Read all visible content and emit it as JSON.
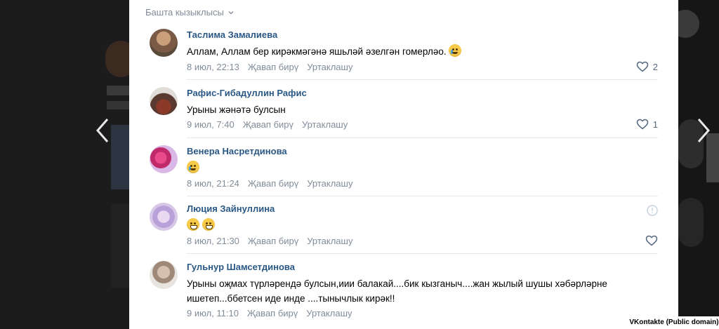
{
  "sort_label": "Башта кызыклысы",
  "credit": "VKontakte (Public domain)",
  "colors": {
    "link": "#2a5885",
    "meta": "#818c99",
    "background": "#ffffff"
  },
  "comments": [
    {
      "author": "Таслима Замалиева",
      "text": "Аллам, Аллам бер кирәкмәгәнә яшьләй әзелгән гомерләо.",
      "emoji": [
        "crying-face"
      ],
      "time": "8 июл, 22:13",
      "reply": "Җавап бирү",
      "share": "Уртаклашу",
      "likes": "2"
    },
    {
      "author": "Рафис-Гибадуллин Рафис",
      "text": "Урыны жәнәтә булсын",
      "emoji": [],
      "time": "9 июл, 7:40",
      "reply": "Җавап бирү",
      "share": "Уртаклашу",
      "likes": "1"
    },
    {
      "author": "Венера Насретдинова",
      "text": "",
      "emoji": [
        "crying-face"
      ],
      "time": "8 июл, 21:24",
      "reply": "Җавап бирү",
      "share": "Уртаклашу",
      "likes": ""
    },
    {
      "author": "Люция Зайнуллина",
      "text": "",
      "emoji": [
        "grimacing-face",
        "grimacing-face"
      ],
      "time": "8 июл, 21:30",
      "reply": "Җавап бирү",
      "share": "Уртаклашу",
      "likes": ""
    },
    {
      "author": "Гульнур Шамсетдинова",
      "text": "Урыны оҗмах түрләрендә булсын,иии балакай....бик кызганыч....жан жылый шушы хәбәрләрне ишетеп...ббетсен иде инде ....тынычлык кирәк!!",
      "emoji": [],
      "time": "9 июл, 11:10",
      "reply": "Җавап бирү",
      "share": "Уртаклашу",
      "likes": ""
    }
  ]
}
